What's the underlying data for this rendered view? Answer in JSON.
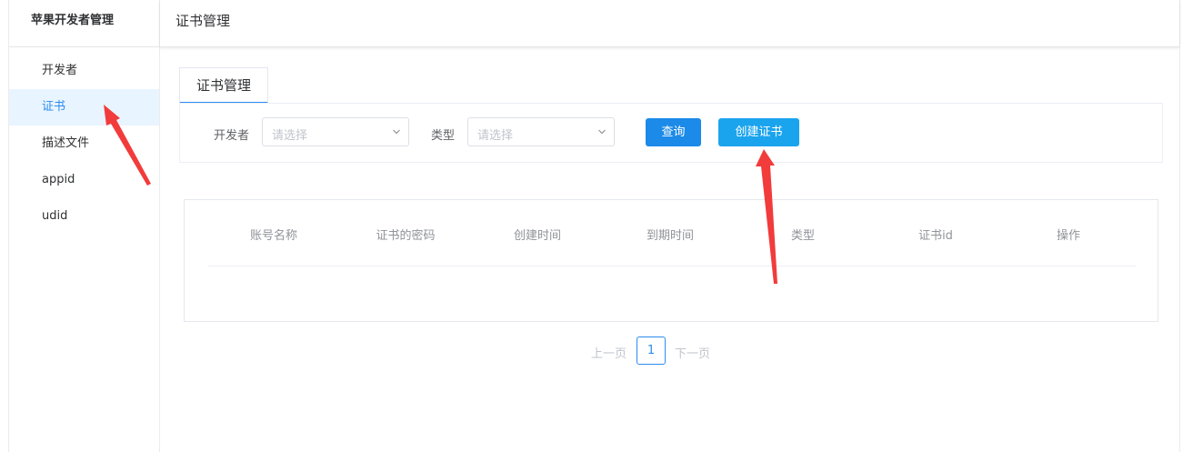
{
  "sidebar": {
    "title": "苹果开发者管理",
    "items": [
      {
        "label": "开发者",
        "active": false
      },
      {
        "label": "证书",
        "active": true
      },
      {
        "label": "描述文件",
        "active": false
      },
      {
        "label": "appid",
        "active": false
      },
      {
        "label": "udid",
        "active": false
      }
    ]
  },
  "header": {
    "title": "证书管理"
  },
  "tabs": [
    {
      "label": "证书管理",
      "active": true
    }
  ],
  "filters": {
    "developer": {
      "label": "开发者",
      "placeholder": "请选择"
    },
    "type": {
      "label": "类型",
      "placeholder": "请选择"
    }
  },
  "buttons": {
    "query": "查询",
    "create": "创建证书"
  },
  "table": {
    "columns": [
      "账号名称",
      "证书的密码",
      "创建时间",
      "到期时间",
      "类型",
      "证书id",
      "操作"
    ],
    "rows": []
  },
  "pagination": {
    "prev": "上一页",
    "current": "1",
    "next": "下一页"
  },
  "annotations": {
    "arrow_color": "#f23b3b"
  },
  "colors": {
    "accent": "#2d8cf0",
    "query_button": "#1c8ae8",
    "create_button": "#1ba4ee",
    "active_item_bg": "#e8f4ff"
  }
}
